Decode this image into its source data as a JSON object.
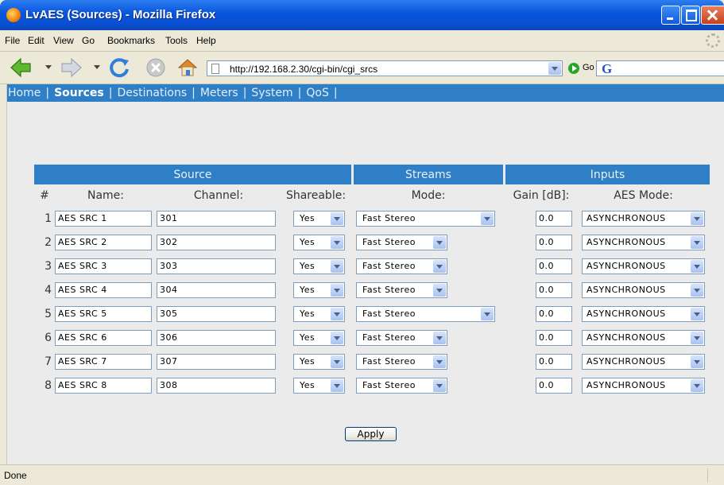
{
  "window": {
    "title": "LvAES (Sources) - Mozilla Firefox"
  },
  "menu": [
    "File",
    "Edit",
    "View",
    "Go",
    "Bookmarks",
    "Tools",
    "Help"
  ],
  "browser": {
    "url": "http://192.168.2.30/cgi-bin/cgi_srcs",
    "go_label": "Go",
    "search_logo": "G"
  },
  "sitenav": {
    "items": [
      "Home",
      "Sources",
      "Destinations",
      "Meters",
      "System",
      "QoS"
    ],
    "active": "Sources",
    "separator": "|"
  },
  "table": {
    "groups": {
      "source": "Source",
      "streams": "Streams",
      "inputs": "Inputs"
    },
    "columns": {
      "num": "#",
      "name": "Name:",
      "channel": "Channel:",
      "shareable": "Shareable:",
      "mode": "Mode:",
      "gain": "Gain [dB]:",
      "aes_mode": "AES Mode:"
    },
    "rows": [
      {
        "num": "1",
        "name": "AES SRC 1",
        "channel": "301",
        "shareable": "Yes",
        "mode": "Fast Stereo",
        "gain": "0.0",
        "aes_mode": "ASYNCHRONOUS",
        "wide_mode": true
      },
      {
        "num": "2",
        "name": "AES SRC 2",
        "channel": "302",
        "shareable": "Yes",
        "mode": "Fast Stereo",
        "gain": "0.0",
        "aes_mode": "ASYNCHRONOUS",
        "wide_mode": false
      },
      {
        "num": "3",
        "name": "AES SRC 3",
        "channel": "303",
        "shareable": "Yes",
        "mode": "Fast Stereo",
        "gain": "0.0",
        "aes_mode": "ASYNCHRONOUS",
        "wide_mode": false
      },
      {
        "num": "4",
        "name": "AES SRC 4",
        "channel": "304",
        "shareable": "Yes",
        "mode": "Fast Stereo",
        "gain": "0.0",
        "aes_mode": "ASYNCHRONOUS",
        "wide_mode": false
      },
      {
        "num": "5",
        "name": "AES SRC 5",
        "channel": "305",
        "shareable": "Yes",
        "mode": "Fast Stereo",
        "gain": "0.0",
        "aes_mode": "ASYNCHRONOUS",
        "wide_mode": true
      },
      {
        "num": "6",
        "name": "AES SRC 6",
        "channel": "306",
        "shareable": "Yes",
        "mode": "Fast Stereo",
        "gain": "0.0",
        "aes_mode": "ASYNCHRONOUS",
        "wide_mode": false
      },
      {
        "num": "7",
        "name": "AES SRC 7",
        "channel": "307",
        "shareable": "Yes",
        "mode": "Fast Stereo",
        "gain": "0.0",
        "aes_mode": "ASYNCHRONOUS",
        "wide_mode": false
      },
      {
        "num": "8",
        "name": "AES SRC 8",
        "channel": "308",
        "shareable": "Yes",
        "mode": "Fast Stereo",
        "gain": "0.0",
        "aes_mode": "ASYNCHRONOUS",
        "wide_mode": false
      }
    ]
  },
  "apply_label": "Apply",
  "status": "Done",
  "colors": {
    "accent": "#2e7fc6",
    "titlebar": "#0855dd",
    "page_bg": "#ebebeb"
  },
  "icons": [
    "firefox-icon",
    "back-arrow-icon",
    "forward-arrow-icon",
    "reload-icon",
    "stop-icon",
    "home-icon",
    "page-icon",
    "go-icon",
    "google-icon"
  ]
}
